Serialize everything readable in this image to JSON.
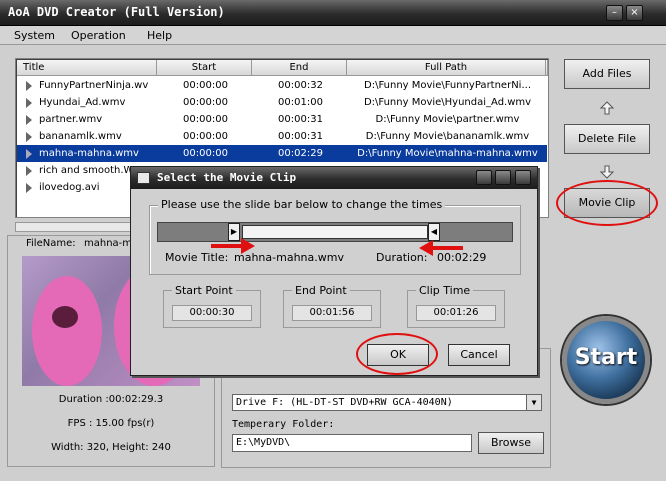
{
  "window": {
    "title": "AoA DVD Creator (Full Version)"
  },
  "menu": [
    "System",
    "Operation",
    "Help"
  ],
  "table": {
    "headers": [
      "Title",
      "Start",
      "End",
      "Full Path"
    ],
    "rows": [
      {
        "title": "FunnyPartnerNinja.wv",
        "start": "00:00:00",
        "end": "00:00:32",
        "path": "D:\\Funny Movie\\FunnyPartnerNi..."
      },
      {
        "title": "Hyundai_Ad.wmv",
        "start": "00:00:00",
        "end": "00:01:00",
        "path": "D:\\Funny Movie\\Hyundai_Ad.wmv"
      },
      {
        "title": "partner.wmv",
        "start": "00:00:00",
        "end": "00:00:31",
        "path": "D:\\Funny Movie\\partner.wmv"
      },
      {
        "title": "bananamlk.wmv",
        "start": "00:00:00",
        "end": "00:00:31",
        "path": "D:\\Funny Movie\\bananamlk.wmv"
      },
      {
        "title": "mahna-mahna.wmv",
        "start": "00:00:00",
        "end": "00:02:29",
        "path": "D:\\Funny Movie\\mahna-mahna.wmv"
      },
      {
        "title": "rich and smooth.W",
        "start": "",
        "end": "",
        "path": ""
      },
      {
        "title": "ilovedog.avi",
        "start": "",
        "end": "",
        "path": ""
      }
    ],
    "selected_index": 4
  },
  "side_buttons": {
    "add": "Add Files",
    "delete": "Delete File",
    "clip": "Movie Clip"
  },
  "preview": {
    "filename_label": "FileName:",
    "filename_value": "mahna-m",
    "duration": "Duration :00:02:29.3",
    "fps": "FPS : 15.00 fps(r)",
    "size": "Width: 320, Height: 240"
  },
  "output": {
    "drive": "Drive F:  (HL-DT-ST DVD+RW GCA-4040N)",
    "temp_label": "Temperary Folder:",
    "temp_value": "E:\\MyDVD\\",
    "browse": "Browse"
  },
  "start_label": "Start",
  "dialog": {
    "title": "Select the Movie Clip",
    "instruction": "Please use the slide bar below to change the times",
    "movie_title_label": "Movie Title:",
    "movie_title": "mahna-mahna.wmv",
    "duration_label": "Duration:",
    "duration": "00:02:29",
    "start_label": "Start Point",
    "start_value": "00:00:30",
    "end_label": "End Point",
    "end_value": "00:01:56",
    "clip_label": "Clip Time",
    "clip_value": "00:01:26",
    "ok": "OK",
    "cancel": "Cancel"
  },
  "colors": {
    "selection": "#0a3c9e",
    "highlight_red": "#e01010"
  }
}
